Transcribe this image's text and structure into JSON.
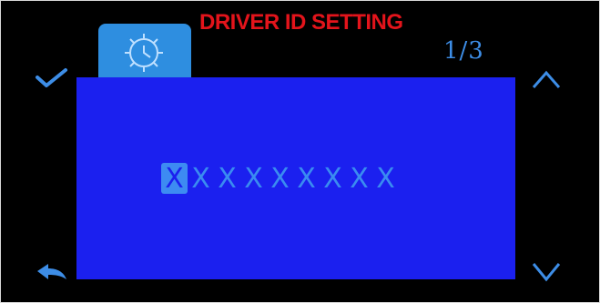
{
  "header": {
    "title": "DRIVER ID SETTING",
    "page_indicator": "1/3",
    "tab_icon": "gear-icon"
  },
  "side_controls": {
    "confirm_icon": "checkmark-icon",
    "back_icon": "back-arrow-icon",
    "up_icon": "chevron-up-icon",
    "down_icon": "chevron-down-icon"
  },
  "driver_id": {
    "characters": [
      "X",
      "X",
      "X",
      "X",
      "X",
      "X",
      "X",
      "X",
      "X"
    ],
    "selected_index": 0
  },
  "colors": {
    "title": "#e3141b",
    "panel": "#1b20ef",
    "accent": "#3d8bf2"
  }
}
